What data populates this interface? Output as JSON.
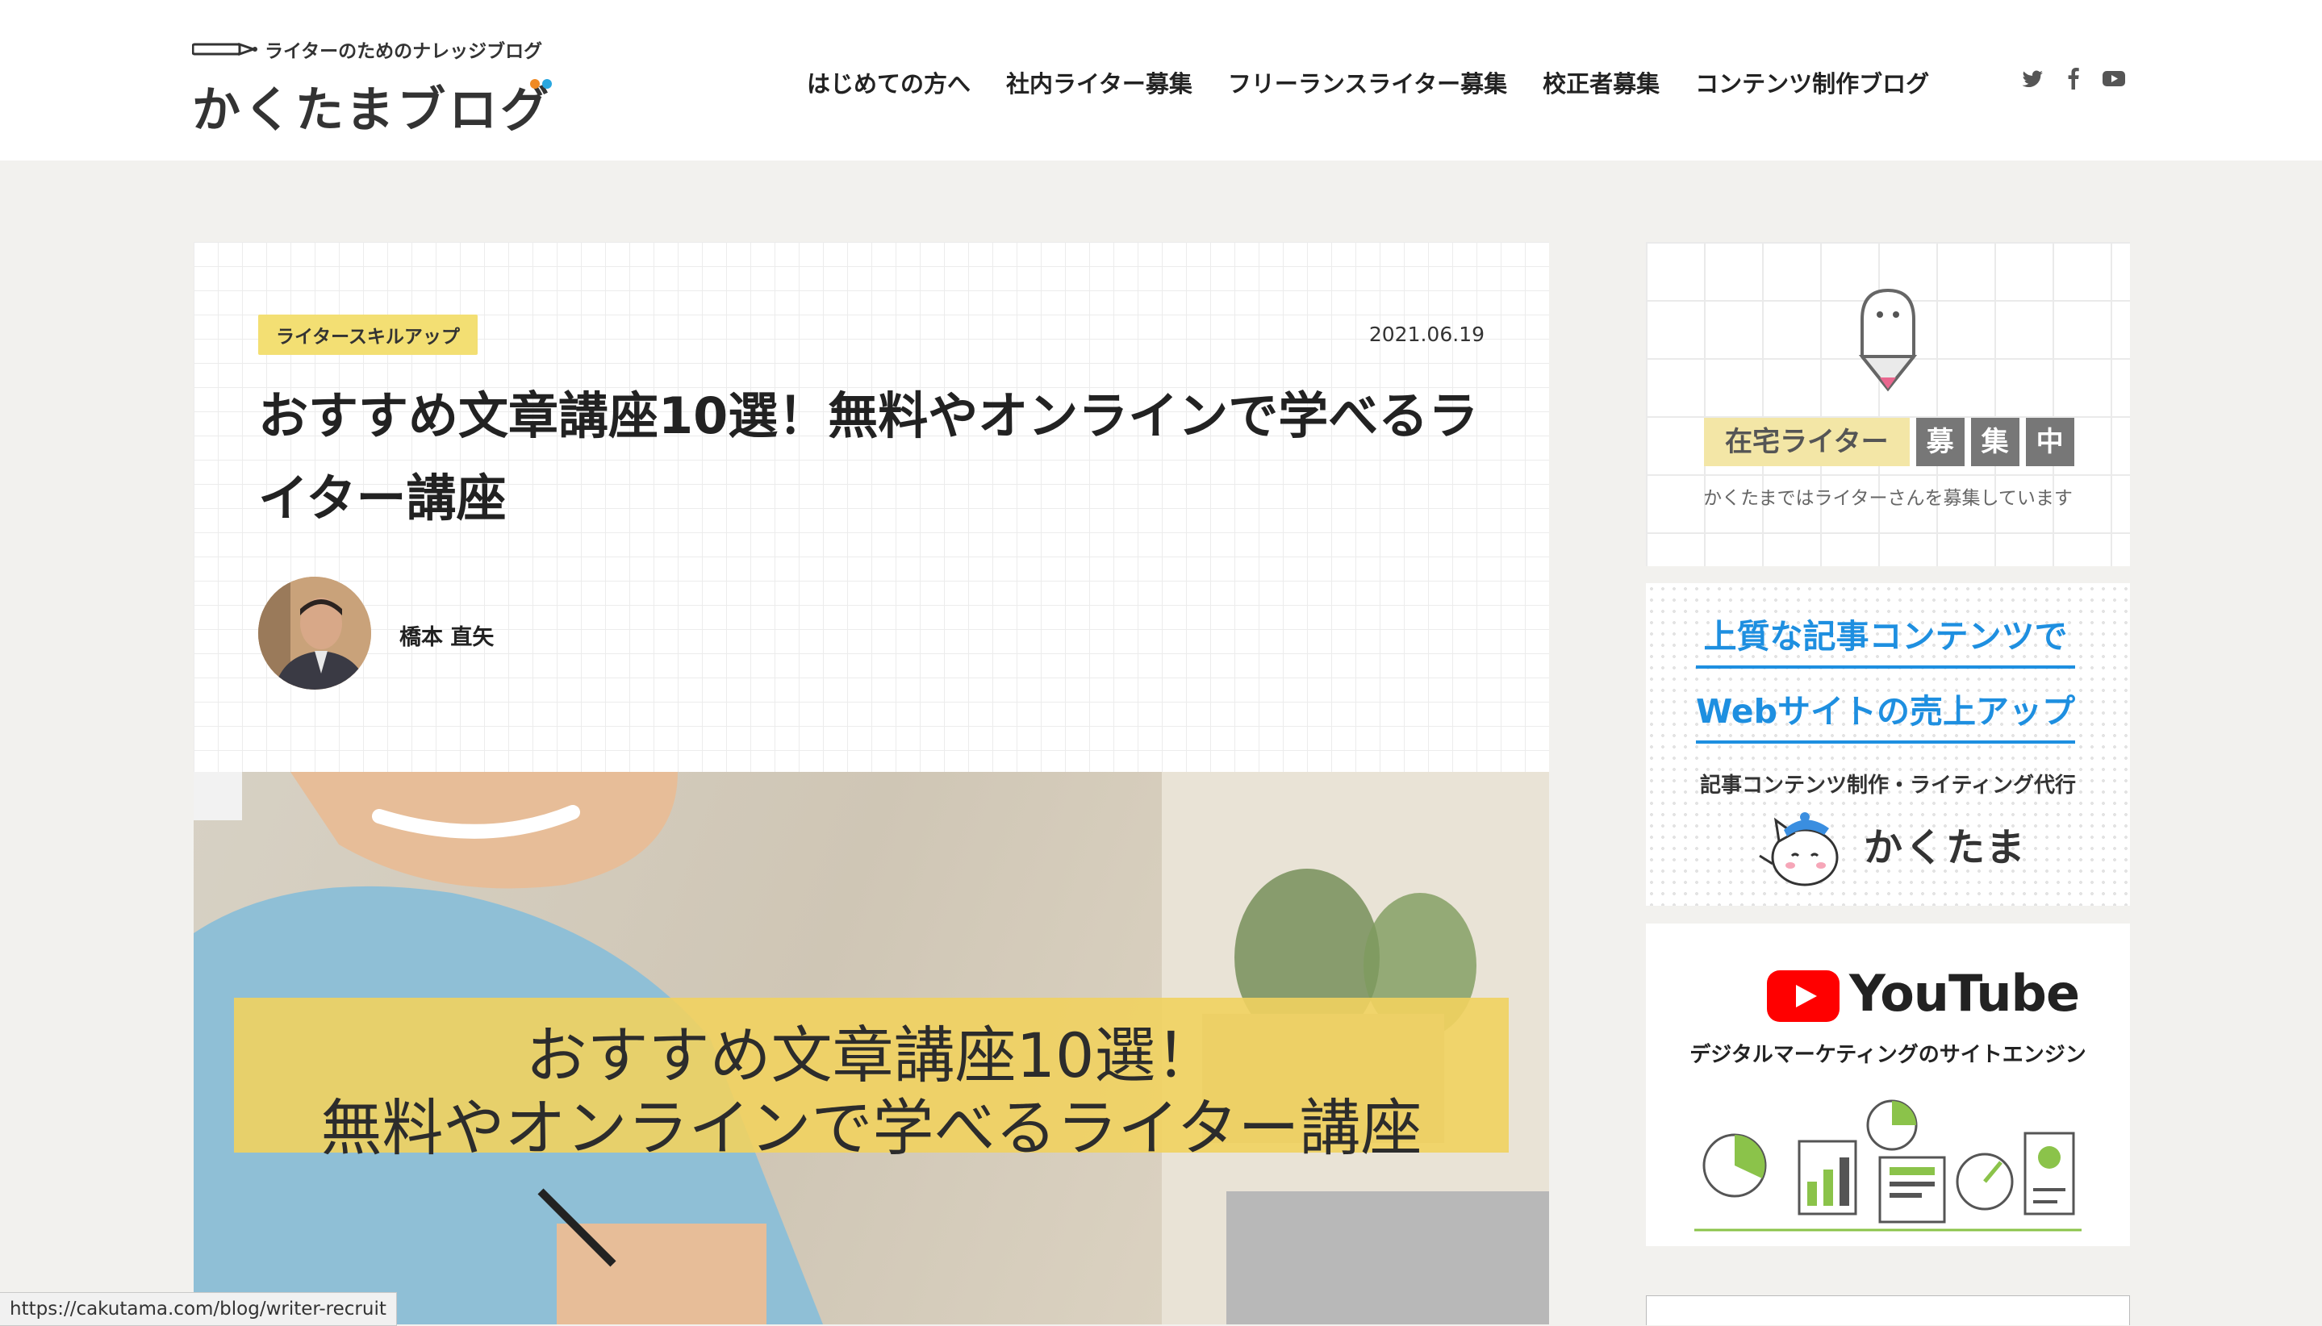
{
  "header": {
    "tagline": "ライターのためのナレッジブログ",
    "site_title": "かくたまブログ",
    "nav": [
      {
        "label": "はじめての方へ"
      },
      {
        "label": "社内ライター募集"
      },
      {
        "label": "フリーランスライター募集"
      },
      {
        "label": "校正者募集"
      },
      {
        "label": "コンテンツ制作ブログ"
      }
    ],
    "social": [
      "twitter-icon",
      "facebook-icon",
      "youtube-icon"
    ]
  },
  "article": {
    "category": "ライタースキルアップ",
    "date": "2021.06.19",
    "title": "おすすめ文章講座10選！無料やオンラインで学べるライター講座",
    "author": "橋本 直矢",
    "hero_line1": "おすすめ文章講座10選！",
    "hero_line2": "無料やオンラインで学べるライター講座"
  },
  "status_bar": {
    "url": "https://cakutama.com/blog/writer-recruit"
  },
  "sidebar": {
    "recruit": {
      "label": "在宅ライター",
      "chars": [
        "募",
        "集",
        "中"
      ],
      "sub": "かくたまではライターさんを募集しています"
    },
    "ad": {
      "line1": "上質な記事コンテンツで",
      "line2": "Webサイトの売上アップ",
      "sub": "記事コンテンツ制作・ライティング代行",
      "brand": "かくたま"
    },
    "youtube": {
      "word": "YouTube",
      "sub": "デジタルマーケティングのサイトエンジン"
    }
  },
  "colors": {
    "accent_yellow": "#f3df73",
    "ad_blue": "#1e8fe0",
    "youtube_red": "#ff0000",
    "page_bg": "#f2f1ee"
  }
}
